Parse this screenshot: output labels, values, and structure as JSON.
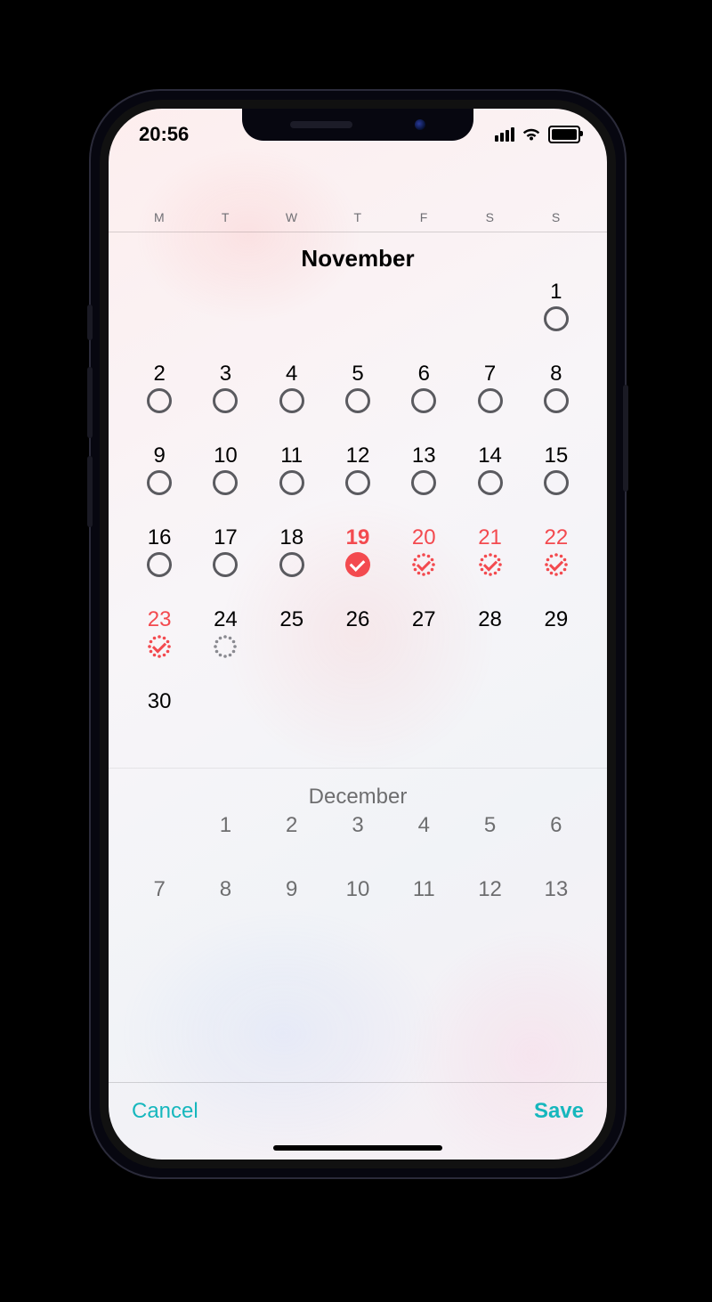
{
  "status": {
    "time": "20:56"
  },
  "weekdays": [
    "M",
    "T",
    "W",
    "T",
    "F",
    "S",
    "S"
  ],
  "footer": {
    "cancel": "Cancel",
    "save": "Save"
  },
  "months": {
    "nov": {
      "title": "November",
      "lead_blanks": 6,
      "days": [
        {
          "n": 1,
          "ind": "ring"
        },
        {
          "n": 2,
          "ind": "ring"
        },
        {
          "n": 3,
          "ind": "ring"
        },
        {
          "n": 4,
          "ind": "ring"
        },
        {
          "n": 5,
          "ind": "ring"
        },
        {
          "n": 6,
          "ind": "ring"
        },
        {
          "n": 7,
          "ind": "ring"
        },
        {
          "n": 8,
          "ind": "ring"
        },
        {
          "n": 9,
          "ind": "ring"
        },
        {
          "n": 10,
          "ind": "ring"
        },
        {
          "n": 11,
          "ind": "ring"
        },
        {
          "n": 12,
          "ind": "ring"
        },
        {
          "n": 13,
          "ind": "ring"
        },
        {
          "n": 14,
          "ind": "ring"
        },
        {
          "n": 15,
          "ind": "ring"
        },
        {
          "n": 16,
          "ind": "ring"
        },
        {
          "n": 17,
          "ind": "ring"
        },
        {
          "n": 18,
          "ind": "ring"
        },
        {
          "n": 19,
          "ind": "solid",
          "style": "today"
        },
        {
          "n": 20,
          "ind": "dotted-red",
          "style": "period"
        },
        {
          "n": 21,
          "ind": "dotted-red",
          "style": "period"
        },
        {
          "n": 22,
          "ind": "dotted-red",
          "style": "period"
        },
        {
          "n": 23,
          "ind": "dotted-red",
          "style": "period"
        },
        {
          "n": 24,
          "ind": "dotted-grey"
        },
        {
          "n": 25,
          "ind": "none"
        },
        {
          "n": 26,
          "ind": "none"
        },
        {
          "n": 27,
          "ind": "none"
        },
        {
          "n": 28,
          "ind": "none"
        },
        {
          "n": 29,
          "ind": "none"
        },
        {
          "n": 30,
          "ind": "none"
        }
      ]
    },
    "dec": {
      "title": "December",
      "lead_blanks": 1,
      "days": [
        1,
        2,
        3,
        4,
        5,
        6,
        7,
        8,
        9,
        10,
        11,
        12,
        13
      ]
    }
  }
}
